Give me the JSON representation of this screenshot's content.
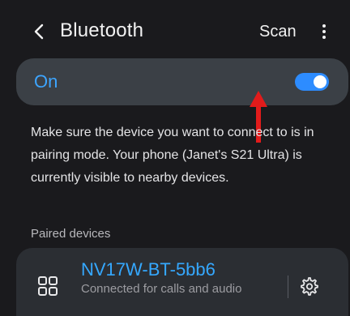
{
  "header": {
    "title": "Bluetooth",
    "scan_label": "Scan"
  },
  "toggle": {
    "label": "On",
    "state": "on"
  },
  "info_text": "Make sure the device you want to connect to is in pairing mode. Your phone (Janet's S21 Ultra) is currently visible to nearby devices.",
  "paired": {
    "section_title": "Paired devices",
    "devices": [
      {
        "name": "NV17W-BT-5bb6",
        "status": "Connected for calls and audio"
      }
    ]
  },
  "colors": {
    "accent": "#2d8cff",
    "annotation_arrow": "#e21b1b"
  },
  "icons": [
    "back-arrow-icon",
    "more-options-icon",
    "device-grid-icon",
    "settings-gear-icon",
    "red-annotation-arrow"
  ]
}
